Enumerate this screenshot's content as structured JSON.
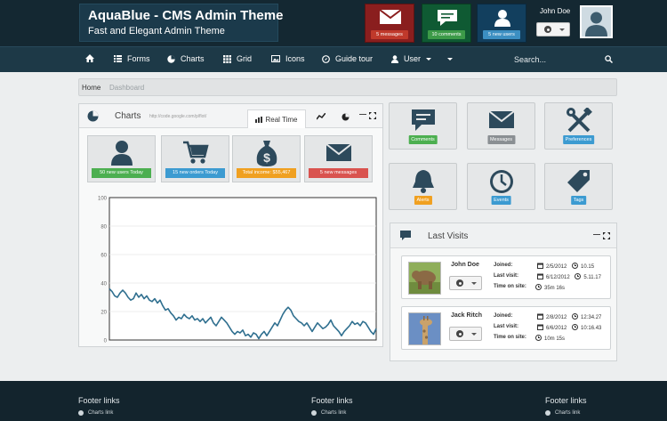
{
  "brand": {
    "title": "AquaBlue - CMS Admin Theme",
    "subtitle": "Fast and Elegant Admin Theme"
  },
  "header_boxes": [
    {
      "icon": "envelope-icon",
      "label": "5 messages",
      "bg": "#8a1e1e",
      "badge": "#c0392b"
    },
    {
      "icon": "comment-icon",
      "label": "10 comments",
      "bg": "#0f5a33",
      "badge": "#3c9a48"
    },
    {
      "icon": "user-icon",
      "label": "5 new users",
      "bg": "#123f5e",
      "badge": "#3c8fc2"
    }
  ],
  "user": {
    "name": "John Doe"
  },
  "nav": {
    "items": [
      {
        "label": "",
        "icon": "home-icon"
      },
      {
        "label": "Forms",
        "icon": "list-icon"
      },
      {
        "label": "Charts",
        "icon": "pie-chart-icon"
      },
      {
        "label": "Grid",
        "icon": "grid-icon"
      },
      {
        "label": "Icons",
        "icon": "image-icon"
      },
      {
        "label": "Guide tour",
        "icon": "compass-icon"
      },
      {
        "label": "User",
        "icon": "user-icon"
      }
    ],
    "search_placeholder": "Search..."
  },
  "breadcrumb": {
    "home": "Home",
    "current": "Dashboard"
  },
  "charts_panel": {
    "title": "Charts",
    "url": "http://code.google.com/p/flot/",
    "tab_label": "Real Time",
    "stats": [
      {
        "icon": "user-icon",
        "label": "50 new users Today",
        "color": "#4caf50"
      },
      {
        "icon": "cart-icon",
        "label": "15 new orders Today",
        "color": "#3c9bd1"
      },
      {
        "icon": "money-bag-icon",
        "label": "Total income: $55,467",
        "color": "#f0a020"
      },
      {
        "icon": "envelope-icon",
        "label": "5 new messages",
        "color": "#d9534f"
      }
    ]
  },
  "chart_data": {
    "type": "line",
    "ylim": [
      0,
      100
    ],
    "yticks": [
      0,
      20,
      40,
      60,
      80,
      100
    ],
    "series": [
      {
        "values": [
          36,
          34,
          31,
          30,
          33,
          35,
          33,
          30,
          28,
          29,
          33,
          30,
          32,
          29,
          31,
          28,
          27,
          29,
          26,
          28,
          24,
          21,
          22,
          19,
          17,
          14,
          16,
          15,
          18,
          16,
          15,
          17,
          14,
          15,
          13,
          15,
          12,
          14,
          16,
          12,
          10,
          13,
          16,
          14,
          12,
          9,
          6,
          4,
          6,
          5,
          7,
          3,
          4,
          2,
          5,
          4,
          1,
          4,
          6,
          3,
          6,
          9,
          12,
          10,
          14,
          18,
          21,
          23,
          21,
          17,
          15,
          13,
          12,
          10,
          12,
          9,
          6,
          9,
          12,
          10,
          8,
          9,
          11,
          14,
          10,
          8,
          6,
          3,
          6,
          8,
          10,
          13,
          11,
          12,
          10,
          13,
          12,
          9,
          6,
          4,
          8
        ]
      }
    ]
  },
  "quick_tiles": [
    {
      "icon": "comment-icon",
      "label": "Comments",
      "color": "#4caf50"
    },
    {
      "icon": "envelope-icon",
      "label": "Messages",
      "color": "#8a8f93"
    },
    {
      "icon": "tools-icon",
      "label": "Preferences",
      "color": "#3c9bd1"
    },
    {
      "icon": "bell-icon",
      "label": "Alerts",
      "color": "#f0a020"
    },
    {
      "icon": "clock-icon",
      "label": "Events",
      "color": "#3c9bd1"
    },
    {
      "icon": "tag-icon",
      "label": "Tags",
      "color": "#3c9bd1"
    }
  ],
  "last_visits": {
    "title": "Last Visits",
    "labels": {
      "joined": "Joined:",
      "last_visit": "Last visit:",
      "time_on_site": "Time on site:"
    },
    "visits": [
      {
        "name": "John Doe",
        "photo": "bear",
        "joined_date": "2/5/2012",
        "joined_time": "10.15",
        "last_date": "6/12/2012",
        "last_time": "5.11.17",
        "time_on_site": "35m 16s"
      },
      {
        "name": "Jack Ritch",
        "photo": "giraffe",
        "joined_date": "2/8/2012",
        "joined_time": "12:34.27",
        "last_date": "6/6/2012",
        "last_time": "10:16.43",
        "time_on_site": "10m 15s"
      }
    ]
  },
  "footer": {
    "columns": [
      {
        "title": "Footer links",
        "link": "Charts link"
      },
      {
        "title": "Footer links",
        "link": "Charts link"
      },
      {
        "title": "Footer links",
        "link": "Charts link"
      }
    ]
  }
}
